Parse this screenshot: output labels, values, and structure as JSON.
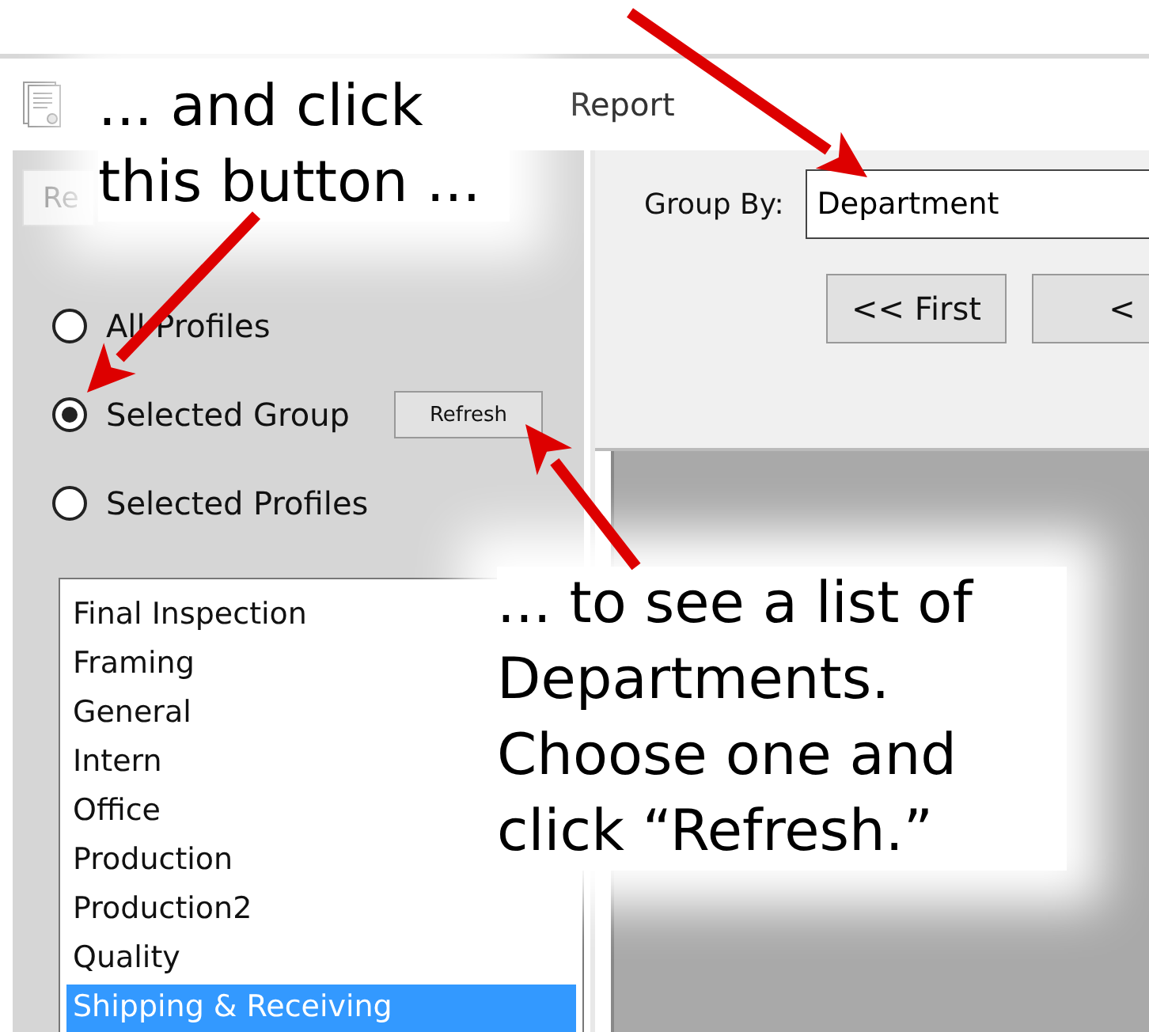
{
  "window": {
    "title": "Report"
  },
  "toolbar_buttons": [
    {
      "label": "Re"
    }
  ],
  "profile_options": [
    {
      "label": "All Profiles",
      "selected": false
    },
    {
      "label": "Selected Group",
      "selected": true
    },
    {
      "label": "Selected Profiles",
      "selected": false
    }
  ],
  "refresh_button": "Refresh",
  "departments": [
    {
      "label": "Final Inspection",
      "selected": false
    },
    {
      "label": "Framing",
      "selected": false
    },
    {
      "label": "General",
      "selected": false
    },
    {
      "label": "Intern",
      "selected": false
    },
    {
      "label": "Office",
      "selected": false
    },
    {
      "label": "Production",
      "selected": false
    },
    {
      "label": "Production2",
      "selected": false
    },
    {
      "label": "Quality",
      "selected": false
    },
    {
      "label": "Shipping & Receiving",
      "selected": true
    }
  ],
  "group_by": {
    "label": "Group By:",
    "value": "Department"
  },
  "nav_buttons": [
    "<< First",
    "<"
  ],
  "callouts": [
    {
      "text": "... and click this button ..."
    },
    {
      "text": "... to see a list of Departments. Choose one and click “Refresh.”"
    }
  ]
}
